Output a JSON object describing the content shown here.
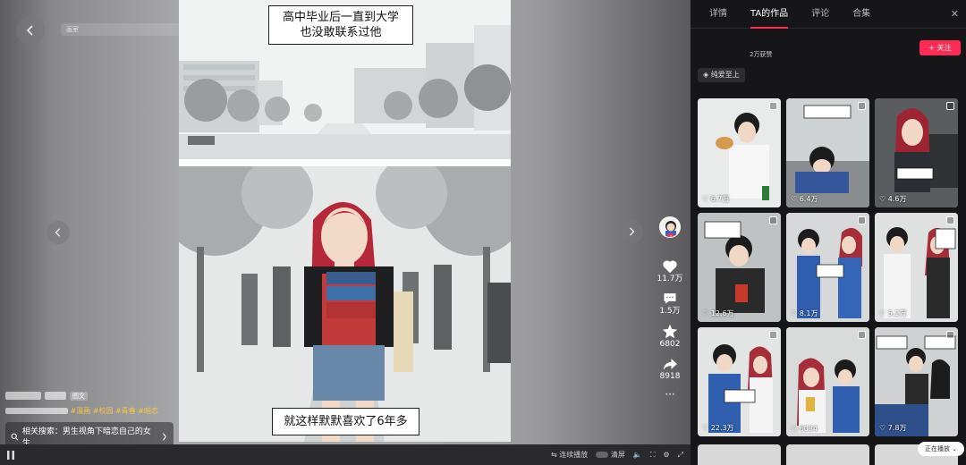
{
  "player": {
    "search_text": "画室",
    "comic": {
      "caption_top_line1": "高中毕业后一直到大学",
      "caption_top_line2": "也没敢联系过他",
      "caption_bottom": "就这样默默喜欢了6年多"
    },
    "actions": {
      "like_count": "11.7万",
      "comment_count": "1.5万",
      "favorite_count": "6802",
      "share_count": "8918",
      "more": "···"
    },
    "info": {
      "author_badge": "图文",
      "tags": [
        "#漫画",
        "#校园",
        "#青春",
        "#暗恋"
      ],
      "related_label": "相关搜索：男生视角下暗恋自己的女生"
    },
    "controls": {
      "continuous_play": "连续播放",
      "clear_label": "清屏"
    }
  },
  "side_panel": {
    "tabs": [
      "详情",
      "TA的作品",
      "评论",
      "合集"
    ],
    "active_tab": "TA的作品",
    "likes_total": "2万获赞",
    "follow_label": "+ 关注",
    "sort_label": "纯爱至上",
    "works": [
      {
        "count": "6.7万"
      },
      {
        "count": "6.4万"
      },
      {
        "count": "4.6万"
      },
      {
        "count": "12.6万"
      },
      {
        "count": "8.1万"
      },
      {
        "count": "5.2万"
      },
      {
        "count": "22.3万"
      },
      {
        "count": "6034"
      },
      {
        "count": "7.8万"
      }
    ],
    "now_playing": "正在播放"
  },
  "colors": {
    "accent": "#fe2c55",
    "panel_bg": "#161618",
    "tag": "#f5c542"
  }
}
